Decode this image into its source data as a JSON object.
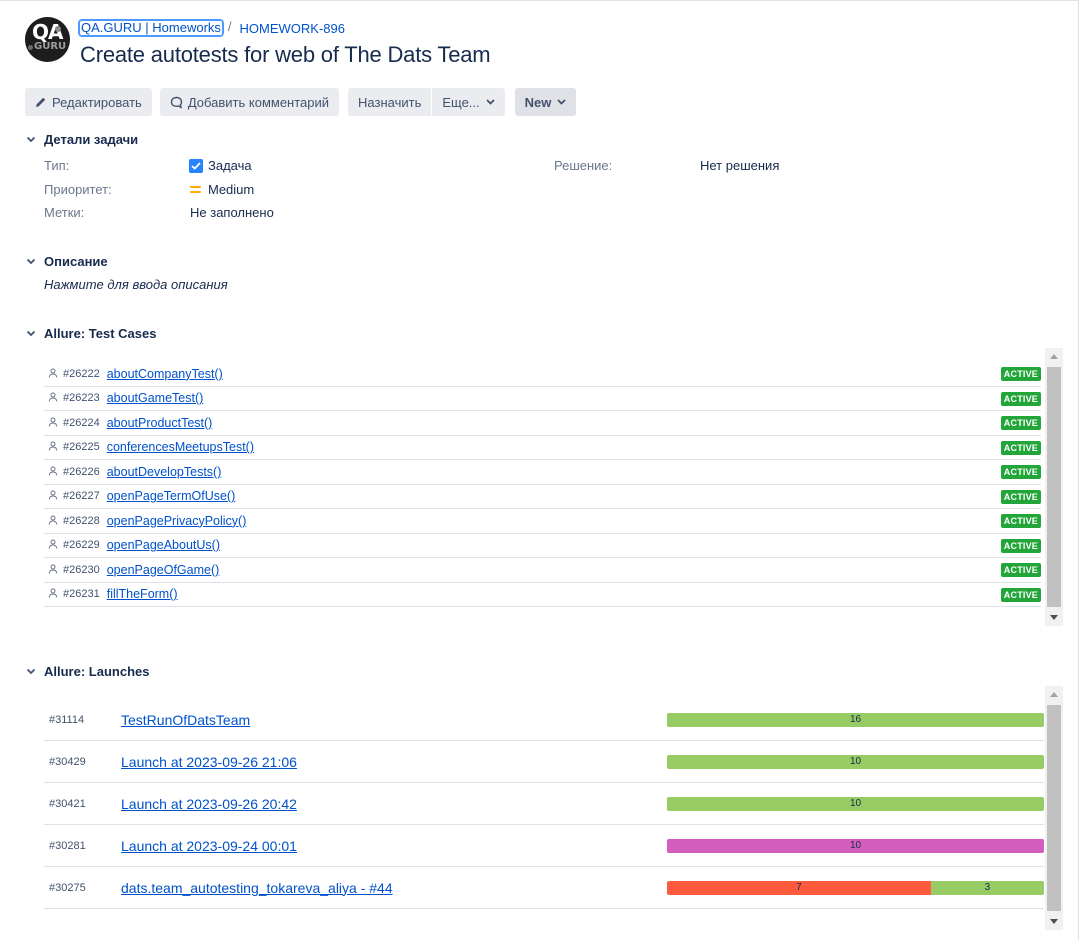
{
  "header": {
    "logo_text_top": "QA",
    "logo_text_bottom": "GURU",
    "project": "QA.GURU | Homeworks",
    "separator": "/",
    "issue_key": "HOMEWORK-896",
    "title": "Create autotests for web of The Dats Team"
  },
  "toolbar": {
    "edit": "Редактировать",
    "comment": "Добавить комментарий",
    "assign": "Назначить",
    "more": "Еще...",
    "status": "New"
  },
  "details": {
    "heading": "Детали задачи",
    "type_label": "Тип:",
    "type_value": "Задача",
    "priority_label": "Приоритет:",
    "priority_value": "Medium",
    "labels_label": "Метки:",
    "labels_value": "Не заполнено",
    "resolution_label": "Решение:",
    "resolution_value": "Нет решения"
  },
  "description": {
    "heading": "Описание",
    "placeholder": "Нажмите для ввода описания"
  },
  "test_cases": {
    "heading": "Allure: Test Cases",
    "rows": [
      {
        "id": "#26222",
        "name": "aboutCompanyTest()",
        "status": "ACTIVE"
      },
      {
        "id": "#26223",
        "name": "aboutGameTest()",
        "status": "ACTIVE"
      },
      {
        "id": "#26224",
        "name": "aboutProductTest()",
        "status": "ACTIVE"
      },
      {
        "id": "#26225",
        "name": "conferencesMeetupsTest()",
        "status": "ACTIVE"
      },
      {
        "id": "#26226",
        "name": "aboutDevelopTests()",
        "status": "ACTIVE"
      },
      {
        "id": "#26227",
        "name": "openPageTermOfUse()",
        "status": "ACTIVE"
      },
      {
        "id": "#26228",
        "name": "openPagePrivacyPolicy()",
        "status": "ACTIVE"
      },
      {
        "id": "#26229",
        "name": "openPageAboutUs()",
        "status": "ACTIVE"
      },
      {
        "id": "#26230",
        "name": "openPageOfGame()",
        "status": "ACTIVE"
      },
      {
        "id": "#26231",
        "name": "fillTheForm()",
        "status": "ACTIVE"
      }
    ]
  },
  "launches": {
    "heading": "Allure: Launches",
    "rows": [
      {
        "id": "#31114",
        "name": "TestRunOfDatsTeam",
        "segments": [
          {
            "value": "16",
            "color": "#97cc64"
          }
        ]
      },
      {
        "id": "#30429",
        "name": "Launch at 2023-09-26 21:06",
        "segments": [
          {
            "value": "10",
            "color": "#97cc64"
          }
        ]
      },
      {
        "id": "#30421",
        "name": "Launch at 2023-09-26 20:42",
        "segments": [
          {
            "value": "10",
            "color": "#97cc64"
          }
        ]
      },
      {
        "id": "#30281",
        "name": "Launch at 2023-09-24 00:01",
        "segments": [
          {
            "value": "10",
            "color": "#d35ebe"
          }
        ]
      },
      {
        "id": "#30275",
        "name": "dats.team_autotesting_tokareva_aliya - #44",
        "segments": [
          {
            "value": "7",
            "color": "#fd5a3e"
          },
          {
            "value": "3",
            "color": "#97cc64"
          }
        ]
      }
    ]
  }
}
